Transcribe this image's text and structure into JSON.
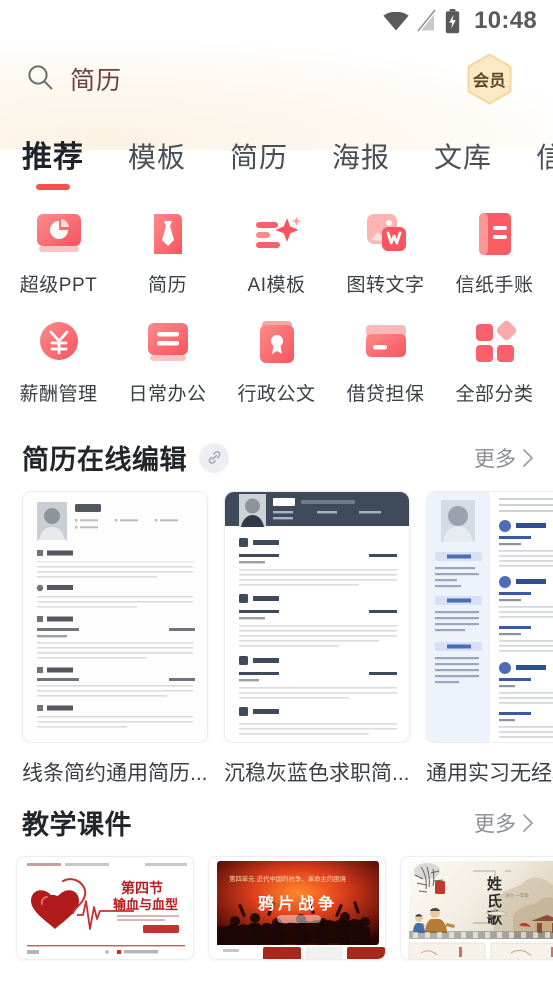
{
  "status_bar": {
    "time": "10:48",
    "icons": [
      "wifi-icon",
      "signal-off-icon",
      "battery-charging-icon"
    ]
  },
  "search": {
    "icon": "search-icon",
    "value": "简历",
    "placeholder": "简历"
  },
  "vip": {
    "label": "会员",
    "icon": "hexagon-badge-icon",
    "color": "#fbe6c0"
  },
  "tabs": {
    "active_index": 0,
    "items": [
      {
        "label": "推荐"
      },
      {
        "label": "模板"
      },
      {
        "label": "简历"
      },
      {
        "label": "海报"
      },
      {
        "label": "文库"
      },
      {
        "label": "信纸"
      }
    ],
    "indicator_color": "#fa4f4f"
  },
  "categories": [
    {
      "label": "超级PPT",
      "icon": "monitor-pie-chart-icon"
    },
    {
      "label": "简历",
      "icon": "necktie-document-icon"
    },
    {
      "label": "AI模板",
      "icon": "ai-sparkle-lines-icon"
    },
    {
      "label": "图转文字",
      "icon": "image-to-word-icon"
    },
    {
      "label": "信纸手账",
      "icon": "letter-paper-icon"
    },
    {
      "label": "薪酬管理",
      "icon": "yuan-circle-icon"
    },
    {
      "label": "日常办公",
      "icon": "monitor-lines-icon"
    },
    {
      "label": "行政公文",
      "icon": "clipboard-seal-icon"
    },
    {
      "label": "借贷担保",
      "icon": "credit-card-icon"
    },
    {
      "label": "全部分类",
      "icon": "grid-squares-icon"
    }
  ],
  "sections": [
    {
      "title": "简历在线编辑",
      "badge_icon": "link-chip-icon",
      "more_label": "更多",
      "more_icon": "chevron-right-icon",
      "cards": [
        {
          "title": "线条简约通用简历...",
          "style": "light-lines"
        },
        {
          "title": "沉稳灰蓝色求职简...",
          "style": "dark-navy-header"
        },
        {
          "title": "通用实习无经验...",
          "style": "blue-two-column"
        }
      ]
    },
    {
      "title": "教学课件",
      "more_label": "更多",
      "more_icon": "chevron-right-icon",
      "cards": [
        {
          "title": "第四节",
          "subtitle": "输血与血型",
          "style": "heart-red"
        },
        {
          "title": "鸦片战争",
          "subtitle": "第四单元 近代中国的抗争、革命主的困境",
          "style": "opium-war"
        },
        {
          "title": "姓氏歌",
          "subtitle": "",
          "style": "ink-painting"
        }
      ]
    }
  ],
  "theme": {
    "accent": "#fa4f4f",
    "accent_soft": "#f8707e",
    "text_primary": "#22262b",
    "text_secondary": "#8a8f96",
    "bg": "#ffffff"
  }
}
